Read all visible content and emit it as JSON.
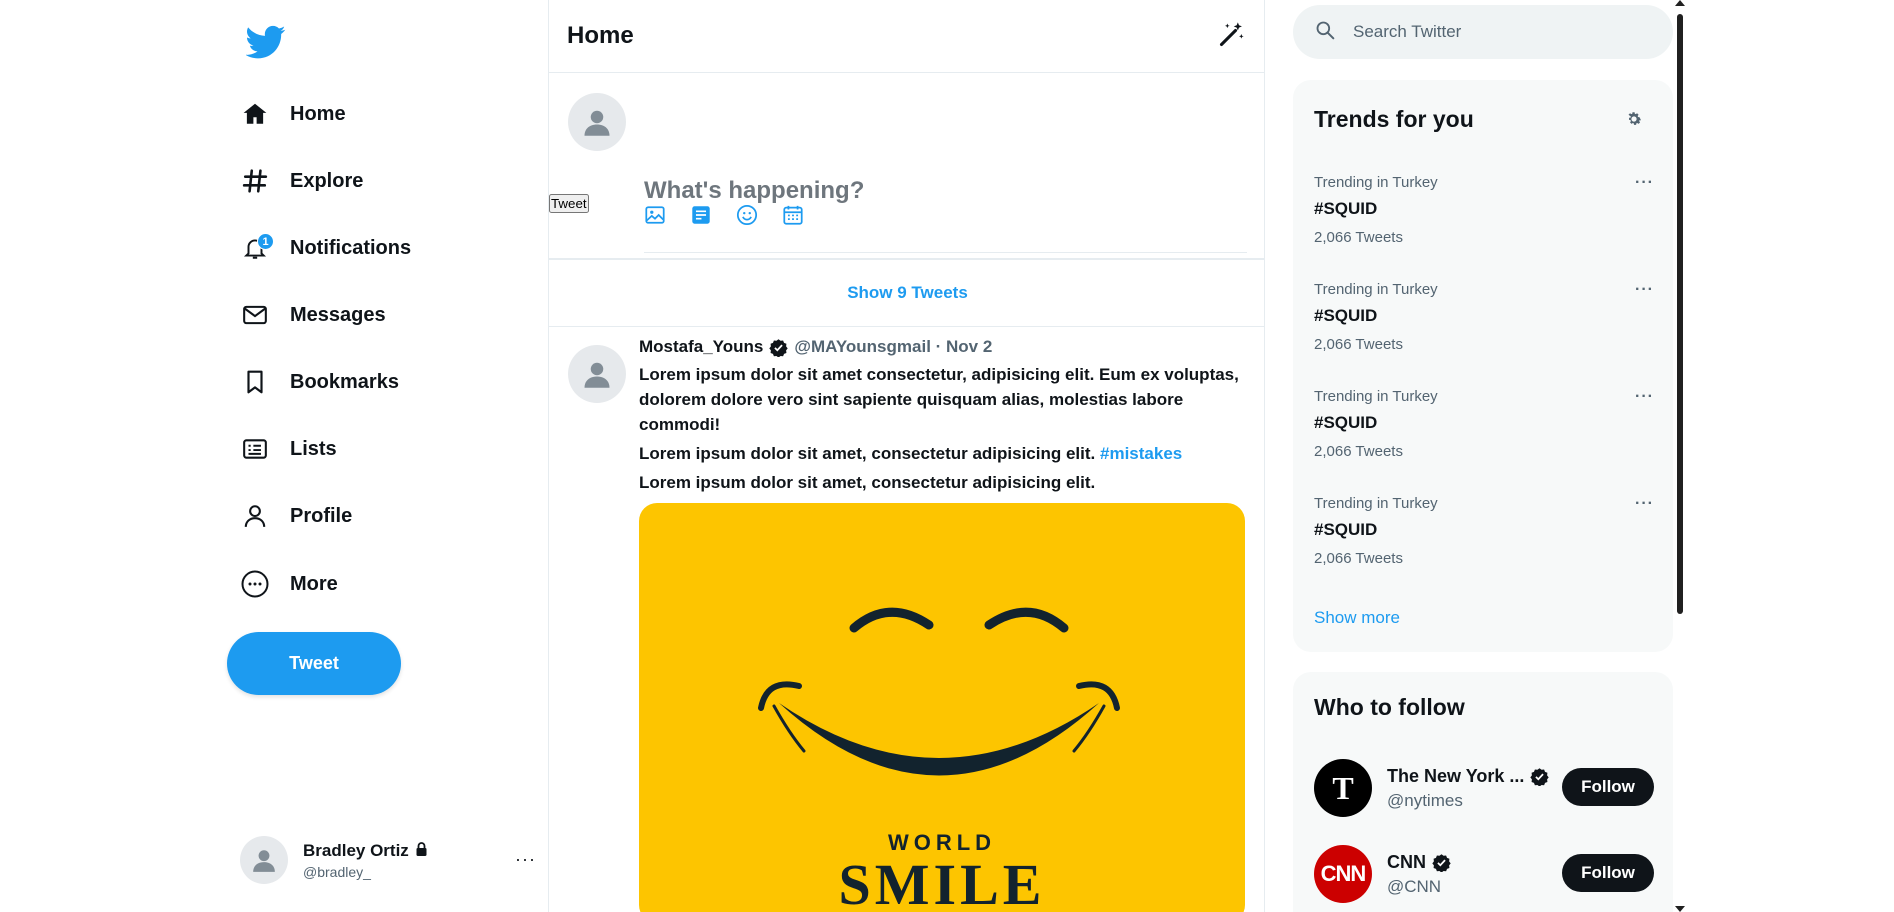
{
  "colors": {
    "accent": "#1d9bf0",
    "accent_light": "#8ecdf8",
    "text": "#0f1419",
    "muted": "#536471",
    "media_bg": "#fdc500",
    "cnn_red": "#cc0000"
  },
  "sidebar": {
    "logo_icon": "twitter-bird-icon",
    "nav": [
      {
        "label": "Home",
        "icon": "home-icon"
      },
      {
        "label": "Explore",
        "icon": "hashtag-icon"
      },
      {
        "label": "Notifications",
        "icon": "bell-icon",
        "badge": "1"
      },
      {
        "label": "Messages",
        "icon": "envelope-icon"
      },
      {
        "label": "Bookmarks",
        "icon": "bookmark-icon"
      },
      {
        "label": "Lists",
        "icon": "list-icon"
      },
      {
        "label": "Profile",
        "icon": "user-icon"
      },
      {
        "label": "More",
        "icon": "more-circle-icon"
      }
    ],
    "tweet_button": "Tweet",
    "account": {
      "name": "Bradley Ortiz",
      "handle": "@bradley_",
      "more": "···"
    }
  },
  "main": {
    "title": "Home",
    "compose": {
      "placeholder": "What's happening?",
      "tweet_button": "Tweet"
    },
    "show_tweets": "Show 9 Tweets",
    "tweet": {
      "name": "Mostafa_Youns",
      "handle_date": "@MAYounsgmail · Nov 2",
      "paragraph1": "Lorem ipsum dolor sit amet consectetur, adipisicing elit. Eum ex voluptas, dolorem dolore vero sint sapiente quisquam alias, molestias labore commodi!",
      "paragraph2": "Lorem ipsum dolor sit amet, consectetur adipisicing elit.",
      "hashtag": "#mistakes",
      "paragraph3": "Lorem ipsum dolor sit amet, consectetur adipisicing elit.",
      "media_text": "WORLD",
      "media_text2": "SMILE"
    }
  },
  "right": {
    "search_placeholder": "Search Twitter",
    "trends_title": "Trends for you",
    "trends": [
      {
        "context": "Trending in Turkey",
        "tag": "#SQUID",
        "count": "2,066 Tweets",
        "more": "···"
      },
      {
        "context": "Trending in Turkey",
        "tag": "#SQUID",
        "count": "2,066 Tweets",
        "more": "···"
      },
      {
        "context": "Trending in Turkey",
        "tag": "#SQUID",
        "count": "2,066 Tweets",
        "more": "···"
      },
      {
        "context": "Trending in Turkey",
        "tag": "#SQUID",
        "count": "2,066 Tweets",
        "more": "···"
      }
    ],
    "show_more": "Show more",
    "follow_title": "Who to follow",
    "follow": [
      {
        "name": "The New York ...",
        "handle": "@nytimes",
        "avatar_text": "T",
        "button": "Follow"
      },
      {
        "name": "CNN",
        "handle": "@CNN",
        "avatar_text": "CNN",
        "button": "Follow"
      }
    ]
  }
}
